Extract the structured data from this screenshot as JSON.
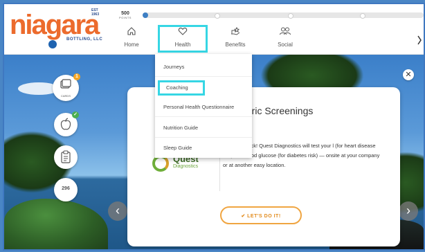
{
  "brand": {
    "logo_text": "niagara",
    "est": "EST 1963",
    "sub": "BOTTLING, LLC"
  },
  "points": {
    "value": "500",
    "label": "POINTS",
    "progress_fraction": 0.02
  },
  "nav": {
    "items": [
      {
        "label": "Home",
        "icon": "home-icon"
      },
      {
        "label": "Health",
        "icon": "heart-icon"
      },
      {
        "label": "Benefits",
        "icon": "benefits-icon"
      },
      {
        "label": "Social",
        "icon": "social-icon"
      }
    ],
    "active_index": 1
  },
  "dropdown": {
    "items": [
      {
        "label": "Journeys"
      },
      {
        "label": "Coaching"
      },
      {
        "label": "Personal Health Questionnaire"
      },
      {
        "label": "Nutrition Guide"
      },
      {
        "label": "Sleep Guide"
      }
    ],
    "active_index": 1
  },
  "tiles": [
    {
      "caption": "CARDS",
      "badge": "1",
      "badge_color": "#f5a623"
    },
    {
      "caption": "",
      "badge": "✓",
      "badge_color": "#4caf50"
    },
    {
      "caption": "",
      "badge": "",
      "badge_color": ""
    },
    {
      "caption": "296",
      "badge": "",
      "badge_color": ""
    }
  ],
  "card": {
    "title": "etric Screenings",
    "body": "k health check! Quest Diagnostics will test your l (for heart disease risk) and blood glucose (for diabetes risk) — onsite at your company or at another easy location.",
    "partner_name": "Quest",
    "partner_sub": "Diagnostics",
    "cta": "LET'S DO IT!"
  },
  "colors": {
    "accent": "#36d6e4",
    "brand_orange": "#ec6b2d",
    "cta": "#f0a541"
  }
}
